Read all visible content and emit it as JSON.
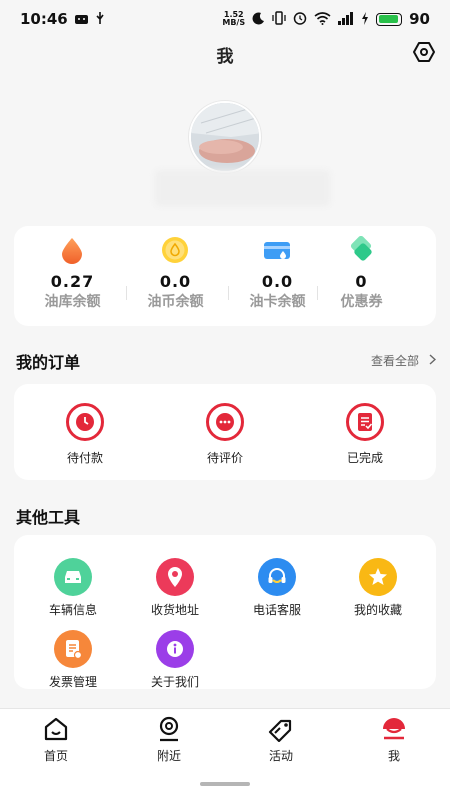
{
  "status_bar": {
    "time": "10:46",
    "net_speed_value": "1.52",
    "net_speed_unit": "MB/S",
    "battery_level": "90",
    "battery_fraction": 0.9,
    "battery_color": "#29c04a"
  },
  "header": {
    "title": "我"
  },
  "wallet": {
    "items": [
      {
        "icon": "oil-drop-icon",
        "value": "0.27",
        "label": "油库余额"
      },
      {
        "icon": "oil-coin-icon",
        "value": "0.0",
        "label": "油币余额"
      },
      {
        "icon": "oil-card-icon",
        "value": "0.0",
        "label": "油卡余额"
      },
      {
        "icon": "coupon-icon",
        "value": "0",
        "label": "优惠券"
      }
    ]
  },
  "orders": {
    "title": "我的订单",
    "view_all": "查看全部",
    "items": [
      {
        "icon": "clock-icon",
        "label": "待付款"
      },
      {
        "icon": "comment-icon",
        "label": "待评价"
      },
      {
        "icon": "document-check-icon",
        "label": "已完成"
      }
    ],
    "accent_color": "#e3283a"
  },
  "tools": {
    "title": "其他工具",
    "items": [
      {
        "icon": "car-icon",
        "label": "车辆信息",
        "color": "#4fd29a"
      },
      {
        "icon": "location-pin-icon",
        "label": "收货地址",
        "color": "#ec3a5a"
      },
      {
        "icon": "headset-icon",
        "label": "电话客服",
        "color": "#2d8cf0"
      },
      {
        "icon": "star-icon",
        "label": "我的收藏",
        "color": "#f9b814"
      },
      {
        "icon": "invoice-icon",
        "label": "发票管理",
        "color": "#f6873a"
      },
      {
        "icon": "info-icon",
        "label": "关于我们",
        "color": "#9b3ee8"
      }
    ]
  },
  "bottom_nav": {
    "items": [
      {
        "icon": "home-icon",
        "label": "首页"
      },
      {
        "icon": "nearby-icon",
        "label": "附近"
      },
      {
        "icon": "activity-tag-icon",
        "label": "活动"
      },
      {
        "icon": "me-icon",
        "label": "我",
        "active": true
      }
    ],
    "active_color": "#e3283a"
  }
}
